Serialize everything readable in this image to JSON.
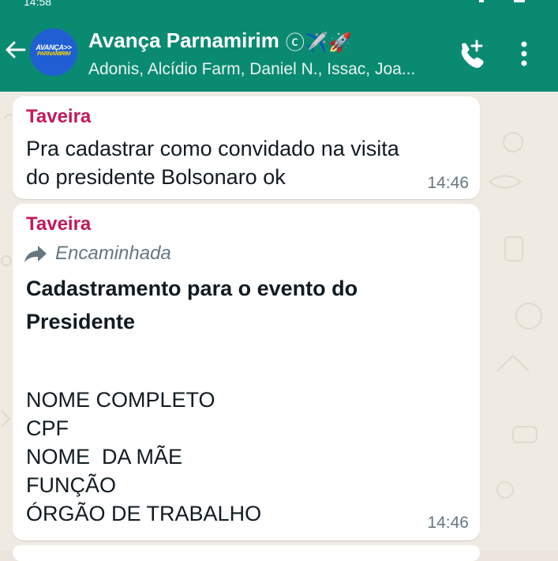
{
  "status_bar": {
    "time": "14:58"
  },
  "header": {
    "back_icon": "arrow-left-icon",
    "avatar_logo_line1": "AVANÇA>>",
    "avatar_logo_line2": "PARNAMIRIM",
    "title": "Avança Parnamirim",
    "title_emojis": "ⓒ✈️🚀",
    "subtitle": "Adonis, Alcídio Farm, Daniel N., Issac, Joa...",
    "add_call_icon": "phone-plus-icon",
    "menu_icon": "more-vertical-icon"
  },
  "messages": [
    {
      "sender": "Taveira",
      "text": "Pra cadastrar como convidado na visita\ndo presidente Bolsonaro ok",
      "time": "14:46"
    },
    {
      "sender": "Taveira",
      "forwarded_label": "Encaminhada",
      "title": "Cadastramento para o evento do Presidente",
      "fields": [
        "NOME COMPLETO",
        "CPF",
        "NOME  DA MÃE",
        "FUNÇÃO",
        "ÓRGÃO DE TRABALHO"
      ],
      "time": "14:46"
    }
  ],
  "colors": {
    "header": "#0b8a72",
    "sender_name": "#c2185b",
    "chat_background": "#efeae2",
    "bubble": "#ffffff"
  }
}
